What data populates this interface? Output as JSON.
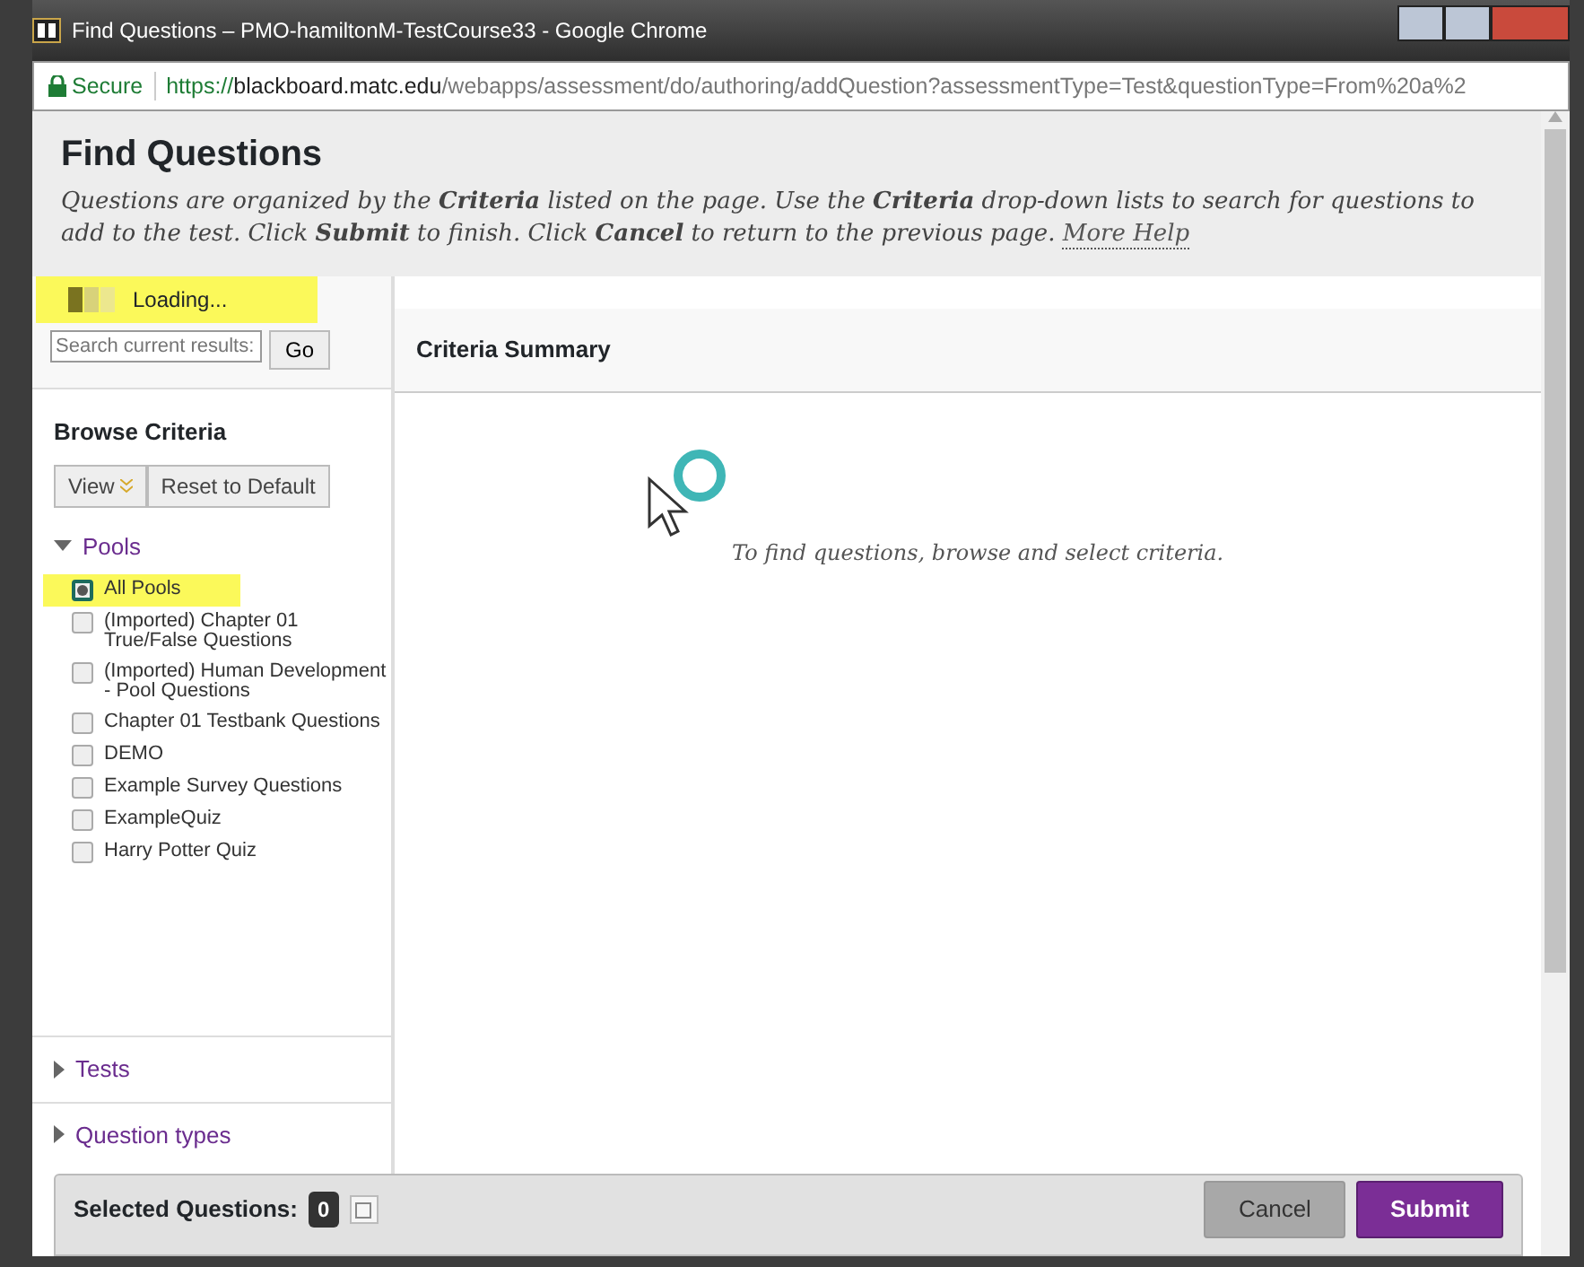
{
  "window": {
    "title": "Find Questions – PMO-hamiltonM-TestCourse33 - Google Chrome"
  },
  "address_bar": {
    "security": "Secure",
    "url_scheme": "https://",
    "url_host": "blackboard.matc.edu",
    "url_path": "/webapps/assessment/do/authoring/addQuestion?assessmentType=Test&questionType=From%20a%2"
  },
  "page": {
    "title": "Find Questions",
    "description": "Questions are organized by the **Criteria** listed on the page. Use the **Criteria** drop-down lists to search for questions to add to the test. Click **Submit** to finish. Click **Cancel** to return to the previous page.",
    "help_link": "More Help"
  },
  "loading": {
    "text": "Loading...",
    "highlighted": true
  },
  "search": {
    "placeholder": "Search current results:",
    "button": "Go"
  },
  "browse": {
    "title": "Browse Criteria",
    "buttons": [
      "View",
      "Reset to Default"
    ],
    "sections": [
      {
        "label": "Pools",
        "expanded": true,
        "items": [
          {
            "label": "All Pools",
            "checked": true,
            "highlighted": true
          },
          {
            "label": "(Imported) Chapter 01 True/False Questions",
            "checked": false,
            "highlighted": false
          },
          {
            "label": "(Imported) Human Development - Pool Questions",
            "checked": false,
            "highlighted": false
          },
          {
            "label": "Chapter 01 Testbank Questions",
            "checked": false,
            "highlighted": false
          },
          {
            "label": "DEMO",
            "checked": false,
            "highlighted": false
          },
          {
            "label": "Example Survey Questions",
            "checked": false,
            "highlighted": false
          },
          {
            "label": "ExampleQuiz",
            "checked": false,
            "highlighted": false
          },
          {
            "label": "Harry Potter Quiz",
            "checked": false,
            "highlighted": false
          }
        ]
      },
      {
        "label": "Tests",
        "expanded": false
      },
      {
        "label": "Question types",
        "expanded": false
      }
    ]
  },
  "summary": {
    "title": "Criteria Summary",
    "message": "To find questions, browse and select criteria."
  },
  "footer": {
    "label": "Selected Questions:",
    "count": "0",
    "buttons": [
      {
        "label": "Cancel",
        "kind": "secondary"
      },
      {
        "label": "Submit",
        "kind": "primary"
      }
    ]
  }
}
